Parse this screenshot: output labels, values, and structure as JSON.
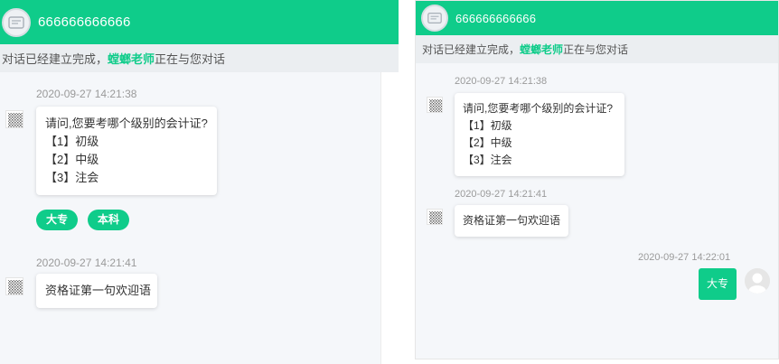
{
  "left": {
    "header_title": "666666666666",
    "notice": {
      "prefix": "对话已经建立完成，",
      "teacher": "螳螂老师",
      "suffix": "正在与您对话"
    },
    "messages": [
      {
        "time": "2020-09-27 14:21:38",
        "lines": [
          "请问,您要考哪个级别的会计证?",
          "【1】初级",
          "【2】中级",
          "【3】注会"
        ]
      },
      {
        "time": "2020-09-27 14:21:41",
        "lines": [
          "资格证第一句欢迎语"
        ]
      }
    ],
    "options": [
      "大专",
      "本科"
    ]
  },
  "right": {
    "header_title": "666666666666",
    "notice": {
      "prefix": "对话已经建立完成，",
      "teacher": "螳螂老师",
      "suffix": "正在与您对话"
    },
    "messages": [
      {
        "time": "2020-09-27 14:21:38",
        "lines": [
          "请问,您要考哪个级别的会计证?",
          "【1】初级",
          "【2】中级",
          "【3】注会"
        ]
      },
      {
        "time": "2020-09-27 14:21:41",
        "lines": [
          "资格证第一句欢迎语"
        ]
      }
    ],
    "sent": {
      "time": "2020-09-27 14:22:01",
      "text": "大专"
    }
  },
  "colors": {
    "accent": "#0fcc8a",
    "timestamp": "#9a9a9a",
    "notice_bg": "#ebeef1"
  }
}
